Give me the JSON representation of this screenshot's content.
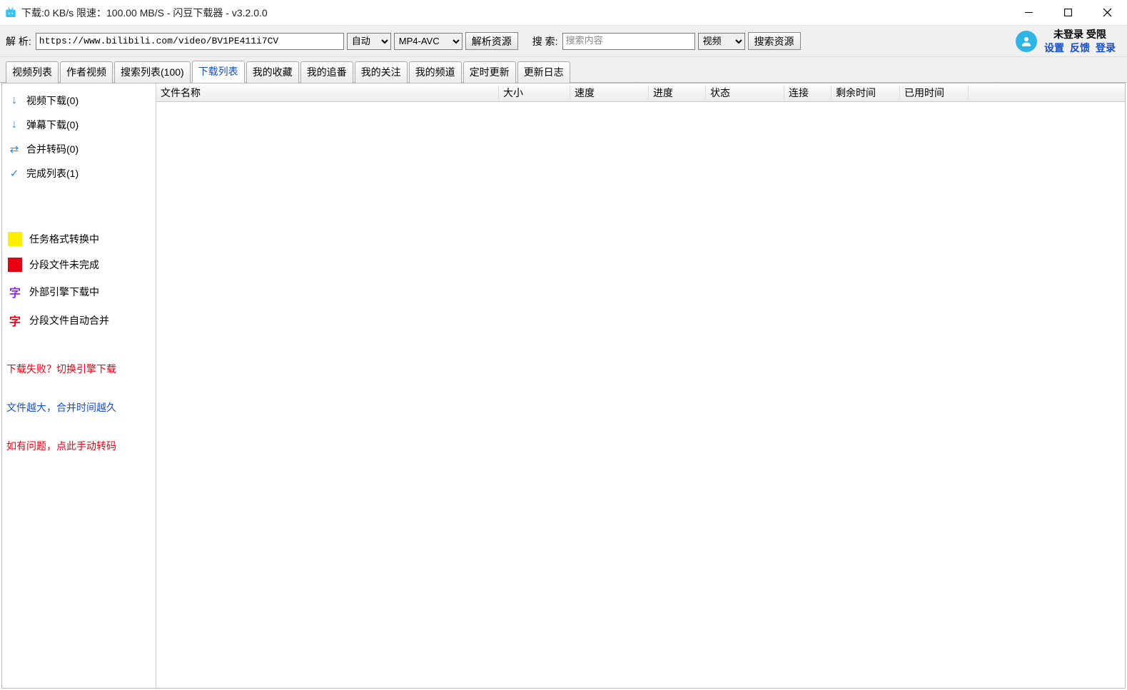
{
  "titlebar": {
    "text": "下载:0 KB/s  限速：100.00 MB/S  - 闪豆下载器 - v3.2.0.0"
  },
  "toolbar": {
    "parse_label": "解  析:",
    "url_value": "https://www.bilibili.com/video/BV1PE411i7CV",
    "auto_option": "自动",
    "format_option": "MP4-AVC",
    "parse_button": "解析资源",
    "search_label": "搜  索:",
    "search_placeholder": "搜索内容",
    "search_type_option": "视频",
    "search_button": "搜索资源"
  },
  "user": {
    "login_status": "未登录  受限",
    "link_settings": "设置",
    "link_feedback": "反馈",
    "link_login": "登录"
  },
  "tabs": [
    {
      "label": "视频列表",
      "active": false
    },
    {
      "label": "作者视频",
      "active": false
    },
    {
      "label": "搜索列表(100)",
      "active": false
    },
    {
      "label": "下载列表",
      "active": true
    },
    {
      "label": "我的收藏",
      "active": false
    },
    {
      "label": "我的追番",
      "active": false
    },
    {
      "label": "我的关注",
      "active": false
    },
    {
      "label": "我的频道",
      "active": false
    },
    {
      "label": "定时更新",
      "active": false
    },
    {
      "label": "更新日志",
      "active": false
    }
  ],
  "sidebar": {
    "items": [
      {
        "label": "视频下载(0)"
      },
      {
        "label": "弹幕下载(0)"
      },
      {
        "label": "合并转码(0)"
      },
      {
        "label": "完成列表(1)"
      }
    ],
    "legend": [
      {
        "label": "任务格式转换中"
      },
      {
        "label": "分段文件未完成"
      },
      {
        "label": "外部引擎下载中"
      },
      {
        "label": "分段文件自动合并"
      }
    ],
    "legend_glyph_2": "字",
    "legend_glyph_3": "字",
    "tips": [
      {
        "label": "下载失败？切换引擎下载"
      },
      {
        "label": "文件越大，合并时间越久"
      },
      {
        "label": "如有问题，点此手动转码"
      }
    ]
  },
  "table": {
    "columns": {
      "filename": "文件名称",
      "size": "大小",
      "speed": "速度",
      "progress": "进度",
      "status": "状态",
      "conn": "连接",
      "remain": "剩余时间",
      "elapsed": "已用时间"
    }
  }
}
